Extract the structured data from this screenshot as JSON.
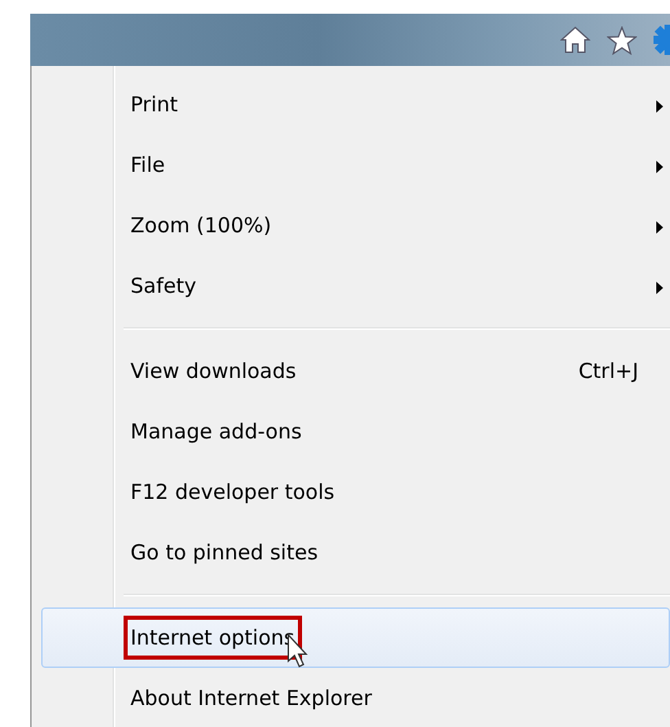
{
  "menu": {
    "sections": [
      {
        "items": [
          {
            "label": "Print",
            "submenu": true,
            "selected": false,
            "outlined": false
          },
          {
            "label": "File",
            "submenu": true,
            "selected": false,
            "outlined": false
          },
          {
            "label": "Zoom (100%)",
            "submenu": true,
            "selected": false,
            "outlined": false
          },
          {
            "label": "Safety",
            "submenu": true,
            "selected": false,
            "outlined": false
          }
        ]
      },
      {
        "items": [
          {
            "label": "View downloads",
            "shortcut": "Ctrl+J",
            "submenu": false,
            "selected": false,
            "outlined": false
          },
          {
            "label": "Manage add-ons",
            "submenu": false,
            "selected": false,
            "outlined": false
          },
          {
            "label": "F12 developer tools",
            "submenu": false,
            "selected": false,
            "outlined": false
          },
          {
            "label": "Go to pinned sites",
            "submenu": false,
            "selected": false,
            "outlined": false
          }
        ]
      },
      {
        "items": [
          {
            "label": "Internet options",
            "submenu": false,
            "selected": true,
            "outlined": true
          },
          {
            "label": "About Internet Explorer",
            "submenu": false,
            "selected": false,
            "outlined": false
          }
        ]
      }
    ]
  }
}
